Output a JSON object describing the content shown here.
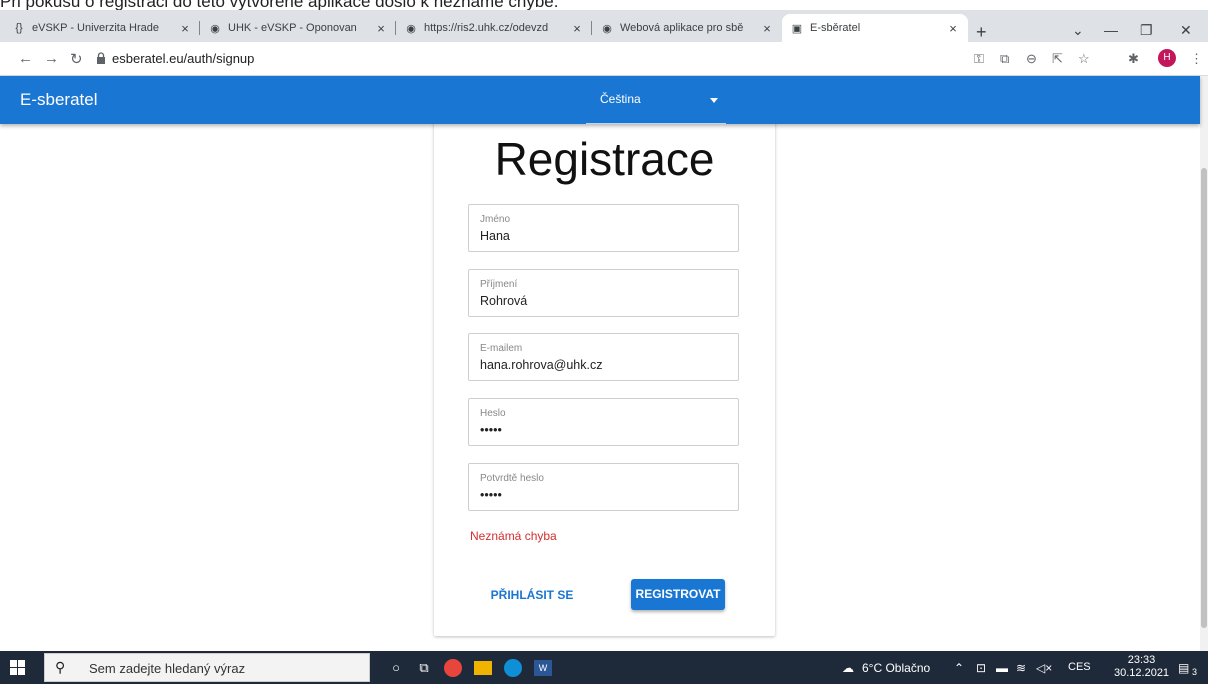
{
  "caption": "Při pokusu o registraci do této vytvořené aplikace došlo k neznámé chybě.",
  "browser": {
    "tabs": [
      {
        "title": "eVSKP - Univerzita Hrade",
        "favicon": "braces-icon"
      },
      {
        "title": "UHK - eVSKP - Oponovan",
        "favicon": "globe-icon"
      },
      {
        "title": "https://ris2.uhk.cz/odevzd",
        "favicon": "globe-icon"
      },
      {
        "title": "Webová aplikace pro sbě",
        "favicon": "globe-icon"
      },
      {
        "title": "E-sběratel",
        "favicon": "app-icon"
      }
    ],
    "new_tab": "+",
    "url": "esberatel.eu/auth/signup",
    "profile_initial": "H"
  },
  "app": {
    "brand": "E-sberatel",
    "language": "Čeština",
    "accent": "#1976d2"
  },
  "form": {
    "title": "Registrace",
    "fields": [
      {
        "label": "Jméno",
        "value": "Hana"
      },
      {
        "label": "Příjmení",
        "value": "Rohrová"
      },
      {
        "label": "E-mailem",
        "value": "hana.rohrova@uhk.cz"
      },
      {
        "label": "Heslo",
        "value": "•••••"
      },
      {
        "label": "Potvrdtě heslo",
        "value": "•••••"
      }
    ],
    "error": "Neznámá chyba",
    "login_button": "PŘIHLÁSIT SE",
    "register_button": "REGISTROVAT",
    "error_color": "#d32f2f"
  },
  "taskbar": {
    "search_placeholder": "Sem zadejte hledaný výraz",
    "weather": "6°C Oblačno",
    "language": "CES",
    "time": "23:33",
    "date": "30.12.2021",
    "notifications": "3"
  }
}
